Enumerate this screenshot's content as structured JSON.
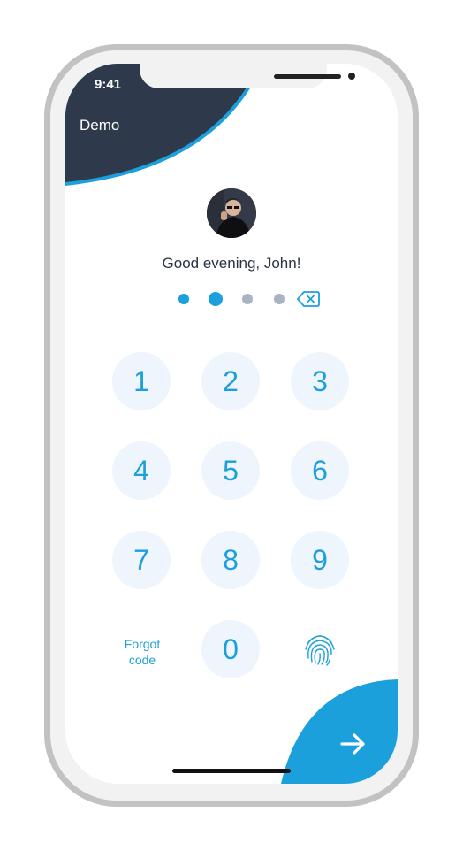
{
  "status_bar": {
    "time": "9:41"
  },
  "header": {
    "title": "Demo"
  },
  "greeting": "Good evening, John!",
  "pin": {
    "entered": 2,
    "length": 4,
    "active_index": 1
  },
  "keypad": {
    "keys": [
      "1",
      "2",
      "3",
      "4",
      "5",
      "6",
      "7",
      "8",
      "9",
      "0"
    ],
    "forgot_line1": "Forgot",
    "forgot_line2": "code"
  },
  "icons": {
    "backspace": "backspace-icon",
    "fingerprint": "fingerprint-icon",
    "next": "arrow-right-icon",
    "avatar": "avatar"
  },
  "colors": {
    "header_dark": "#2e3a4b",
    "accent": "#1ba0dc",
    "key_bg": "#eef5fd",
    "dot_inactive": "#a9b4c3"
  }
}
